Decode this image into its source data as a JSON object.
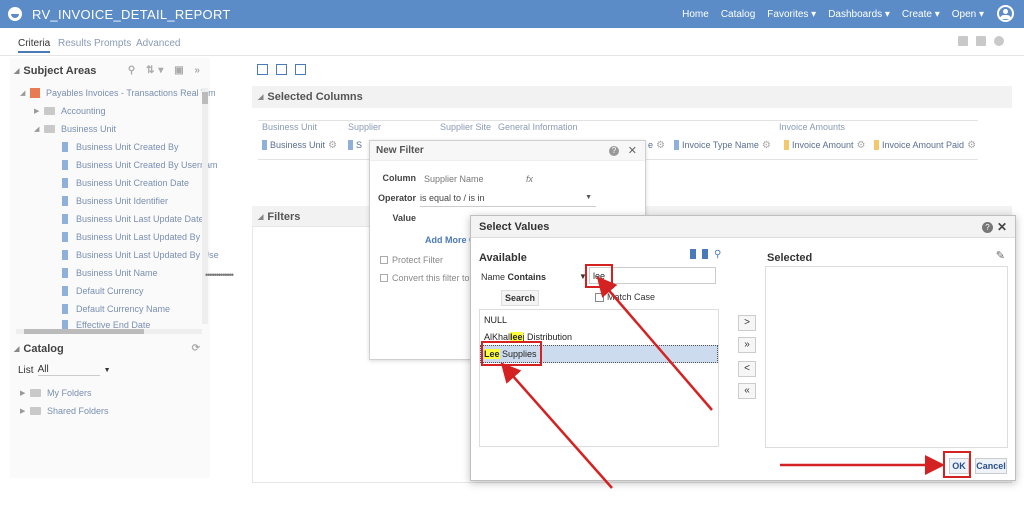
{
  "app": {
    "title": "RV_INVOICE_DETAIL_REPORT"
  },
  "topnav": {
    "home": "Home",
    "catalog": "Catalog",
    "favorites": "Favorites ▾",
    "dashboards": "Dashboards ▾",
    "create": "Create ▾",
    "open": "Open ▾"
  },
  "tabs": {
    "criteria": "Criteria",
    "results": "Results",
    "prompts": "Prompts",
    "advanced": "Advanced"
  },
  "subject_areas": {
    "header": "Subject Areas",
    "root": "Payables Invoices - Transactions Real Tim",
    "accounting": "Accounting",
    "business_unit": "Business Unit",
    "columns": [
      "Business Unit Created By",
      "Business Unit Created By Usernam",
      "Business Unit Creation Date",
      "Business Unit Identifier",
      "Business Unit Last Update Date",
      "Business Unit Last Updated By",
      "Business Unit Last Updated By Use",
      "Business Unit Name",
      "Default Currency",
      "Default Currency Name",
      "Effective End Date"
    ]
  },
  "catalog": {
    "header": "Catalog",
    "list_label": "List",
    "list_value": "All",
    "my_folders": "My Folders",
    "shared_folders": "Shared Folders"
  },
  "selected_columns": {
    "header": "Selected Columns",
    "groups": {
      "business_unit": "Business Unit",
      "supplier": "Supplier",
      "supplier_site": "Supplier Site",
      "general_information": "General Information",
      "invoice_amounts": "Invoice Amounts"
    },
    "chips": {
      "business_unit": "Business Unit",
      "supplier_partial": "S",
      "partial_e": "e",
      "invoice_type_name": "Invoice Type Name",
      "invoice_amount": "Invoice Amount",
      "invoice_amount_paid": "Invoice Amount Paid"
    }
  },
  "filters": {
    "header": "Filters"
  },
  "new_filter": {
    "title": "New Filter",
    "column_label": "Column",
    "column_value": "Supplier Name",
    "fx": "fx",
    "operator_label": "Operator",
    "operator_value": "is equal to / is in",
    "value_label": "Value",
    "add_more": "Add More O",
    "protect_filter": "Protect Filter",
    "convert_filter": "Convert this filter to SC"
  },
  "select_values": {
    "title": "Select Values",
    "available_label": "Available",
    "selected_label": "Selected",
    "name_label": "Name",
    "name_mode": "Contains",
    "search_value": "lee",
    "search_button": "Search",
    "match_case": "Match Case",
    "options": [
      {
        "pre": "NULL",
        "hl": "",
        "post": ""
      },
      {
        "pre": "AlKhal",
        "hl": "lee",
        "post": "j Distribution"
      },
      {
        "pre": "",
        "hl": "Lee",
        "post": " Supplies"
      }
    ],
    "move": ">",
    "move_all": "»",
    "remove": "<",
    "remove_all": "«",
    "ok": "OK",
    "cancel": "Cancel",
    "help": "?",
    "close": "✕"
  },
  "colors": {
    "topbar": "#5b8cc7",
    "accent": "#4b7ab8",
    "annotation": "#d42222",
    "highlight": "#ffff3c",
    "selection": "#cddbee"
  },
  "icons": [
    "logo-icon",
    "user-icon",
    "search-icon",
    "sort-icon",
    "gear-icon",
    "help-icon",
    "close-icon",
    "pencil-icon",
    "folder-icon",
    "column-icon",
    "checkbox-icon"
  ]
}
